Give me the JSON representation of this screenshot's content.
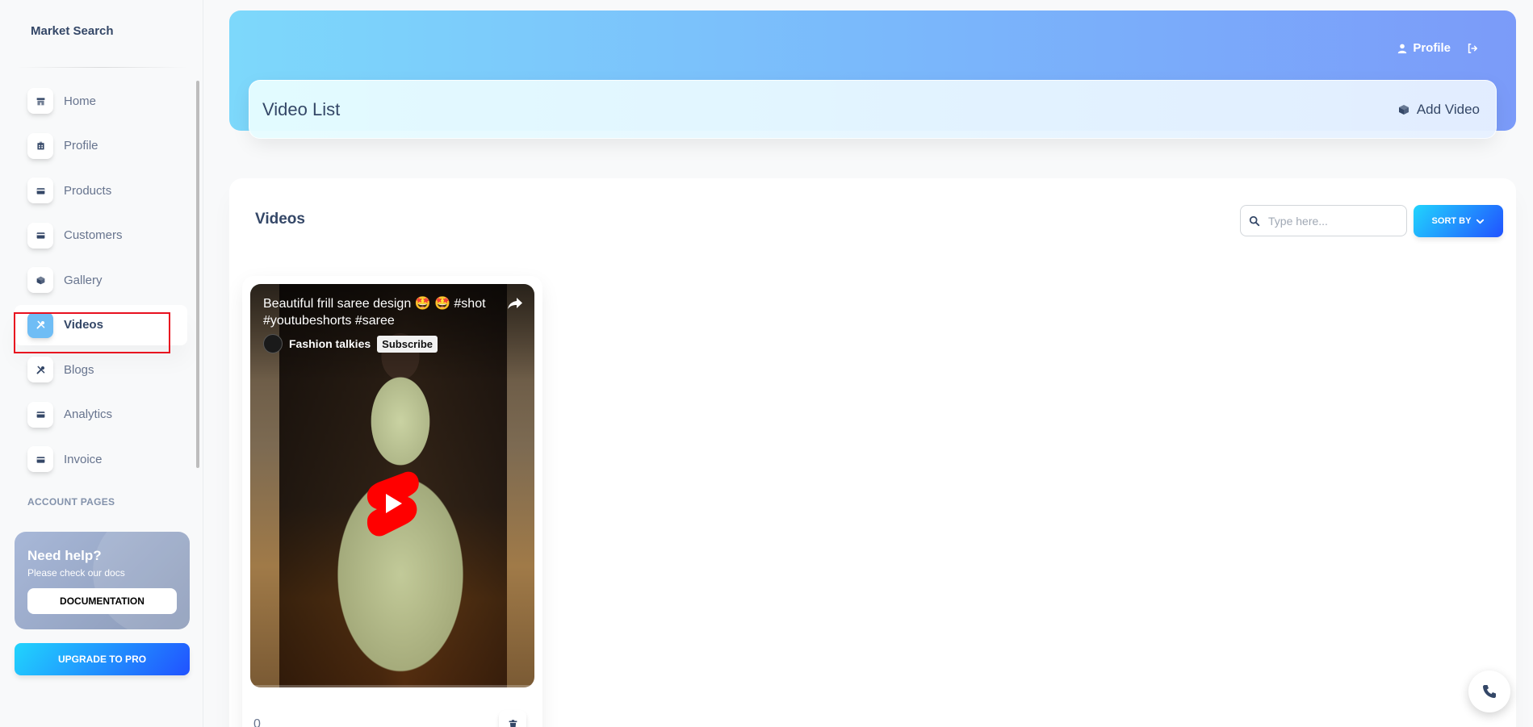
{
  "brand": "Market Search",
  "sidebar": {
    "items": [
      {
        "label": "Home",
        "icon": "shop-icon",
        "active": false
      },
      {
        "label": "Profile",
        "icon": "office-icon",
        "active": false
      },
      {
        "label": "Products",
        "icon": "credit-card-icon",
        "active": false
      },
      {
        "label": "Customers",
        "icon": "credit-card-icon",
        "active": false
      },
      {
        "label": "Gallery",
        "icon": "box-icon",
        "active": false
      },
      {
        "label": "Videos",
        "icon": "tools-icon",
        "active": true
      },
      {
        "label": "Blogs",
        "icon": "tools-icon",
        "active": false
      },
      {
        "label": "Analytics",
        "icon": "credit-card-icon",
        "active": false
      },
      {
        "label": "Invoice",
        "icon": "credit-card-icon",
        "active": false
      }
    ],
    "section_title": "ACCOUNT PAGES",
    "help": {
      "title": "Need help?",
      "subtitle": "Please check our docs",
      "button": "DOCUMENTATION"
    },
    "upgrade_button": "UPGRADE TO PRO"
  },
  "header": {
    "profile_label": "Profile",
    "page_title": "Video List",
    "add_video_label": "Add Video"
  },
  "main": {
    "title": "Videos",
    "search_placeholder": "Type here...",
    "sort_label": "SORT BY",
    "videos": [
      {
        "title": "Beautiful frill saree design 🤩 🤩 #shot #youtubeshorts #saree",
        "channel": "Fashion talkies",
        "subscribe": "Subscribe",
        "count": "0"
      }
    ]
  },
  "colors": {
    "accent_gradient_start": "#21d4fd",
    "accent_gradient_end": "#2152ff",
    "header_gradient_start": "#7dd8fb",
    "header_gradient_end": "#7b9bf9",
    "active_icon_bg": "#6fbdf5",
    "highlight_border": "#e8101f",
    "youtube_red": "#ff0000"
  }
}
